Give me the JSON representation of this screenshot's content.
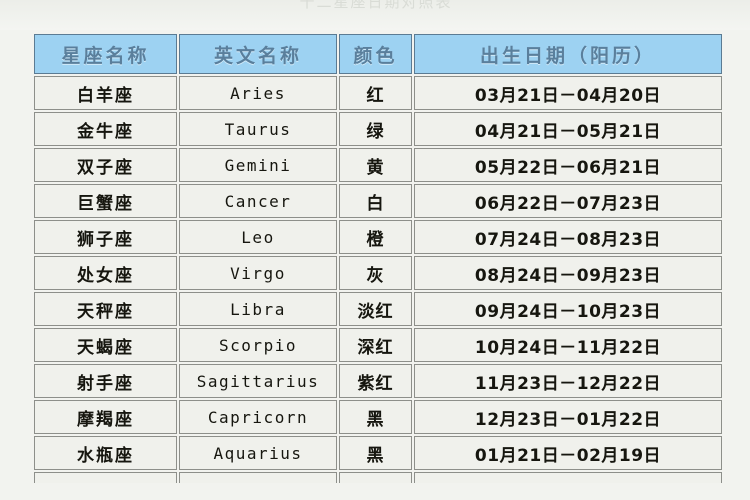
{
  "page": {
    "background_color": "#f2f3ef",
    "clipped_title_fragment": "十二星座日期对照表"
  },
  "table": {
    "header_background": "#9dd2f2",
    "header_text_color": "#5a7f9c",
    "cell_background": "#f0f1ec",
    "border_color": "#8d8f8a",
    "columns": [
      {
        "key": "cn_name",
        "label": "星座名称"
      },
      {
        "key": "en_name",
        "label": "英文名称"
      },
      {
        "key": "color",
        "label": "颜色"
      },
      {
        "key": "date",
        "label": "出生日期（阳历）"
      }
    ],
    "rows": [
      {
        "cn_name": "白羊座",
        "en_name": "Aries",
        "color": "红",
        "date": "03月21日－04月20日"
      },
      {
        "cn_name": "金牛座",
        "en_name": "Taurus",
        "color": "绿",
        "date": "04月21日－05月21日"
      },
      {
        "cn_name": "双子座",
        "en_name": "Gemini",
        "color": "黄",
        "date": "05月22日－06月21日"
      },
      {
        "cn_name": "巨蟹座",
        "en_name": "Cancer",
        "color": "白",
        "date": "06月22日－07月23日"
      },
      {
        "cn_name": "狮子座",
        "en_name": "Leo",
        "color": "橙",
        "date": "07月24日－08月23日"
      },
      {
        "cn_name": "处女座",
        "en_name": "Virgo",
        "color": "灰",
        "date": "08月24日－09月23日"
      },
      {
        "cn_name": "天秤座",
        "en_name": "Libra",
        "color": "淡红",
        "date": "09月24日－10月23日"
      },
      {
        "cn_name": "天蝎座",
        "en_name": "Scorpio",
        "color": "深红",
        "date": "10月24日－11月22日"
      },
      {
        "cn_name": "射手座",
        "en_name": "Sagittarius",
        "color": "紫红",
        "date": "11月23日－12月22日"
      },
      {
        "cn_name": "摩羯座",
        "en_name": "Capricorn",
        "color": "黑",
        "date": "12月23日－01月22日"
      },
      {
        "cn_name": "水瓶座",
        "en_name": "Aquarius",
        "color": "黑",
        "date": "01月21日－02月19日"
      }
    ]
  }
}
